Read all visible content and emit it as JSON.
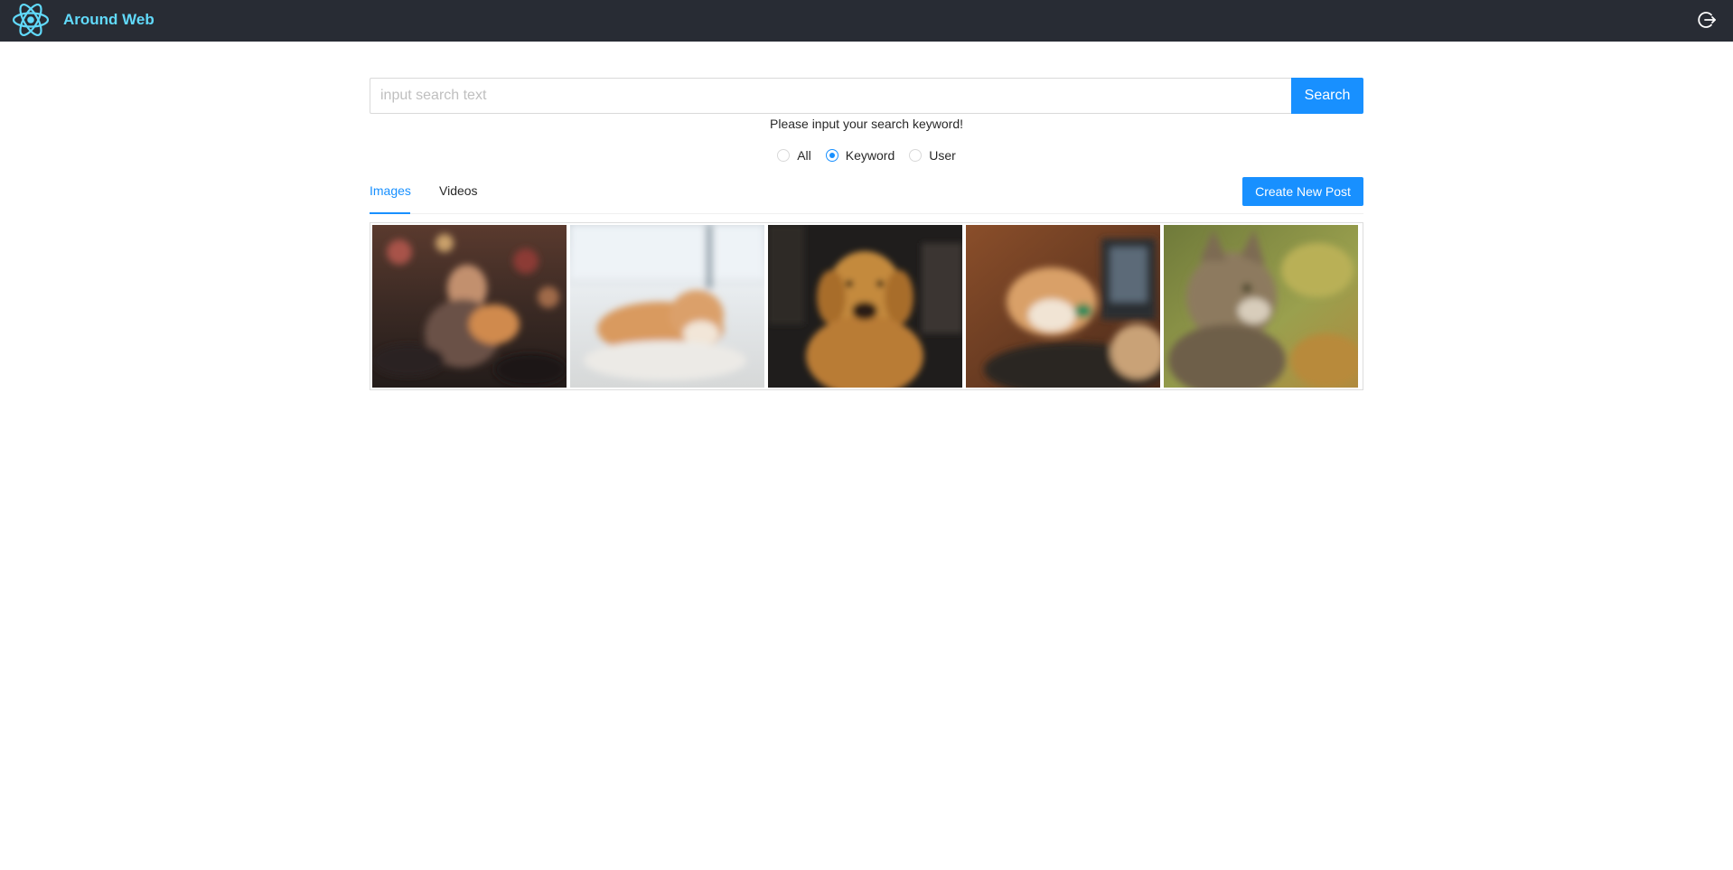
{
  "header": {
    "title": "Around Web",
    "logo_icon": "react-atom-logo",
    "logout_icon": "logout-icon",
    "colors": {
      "background": "#282c34",
      "title": "#61dafb"
    }
  },
  "search": {
    "placeholder": "input search text",
    "value": "",
    "button_label": "Search",
    "hint": "Please input your search keyword!",
    "options": [
      {
        "label": "All",
        "checked": false
      },
      {
        "label": "Keyword",
        "checked": true
      },
      {
        "label": "User",
        "checked": false
      }
    ]
  },
  "tabs": [
    {
      "label": "Images",
      "active": true
    },
    {
      "label": "Videos",
      "active": false
    }
  ],
  "create_post_label": "Create New Post",
  "gallery": {
    "images": [
      {
        "subject": "woman-with-shiba-dog"
      },
      {
        "subject": "shiba-dog-on-rug"
      },
      {
        "subject": "golden-retriever"
      },
      {
        "subject": "shiba-dog-by-laptop"
      },
      {
        "subject": "tabby-cat"
      }
    ]
  },
  "accent_color": "#1890ff"
}
